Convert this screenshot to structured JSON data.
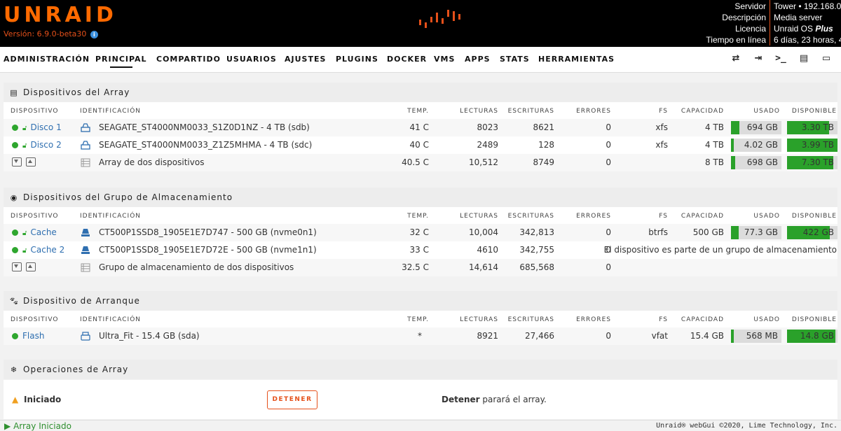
{
  "header": {
    "logo": "UNRAID",
    "version": "Versión: 6.9.0-beta30",
    "server_labels": [
      "Servidor",
      "Descripción",
      "Licencia",
      "Tiempo en línea"
    ],
    "server_values": [
      "Tower • 192.168.0",
      "Media server",
      "Unraid OS ",
      "6 días, 23 horas, 4"
    ],
    "license_plus": "Plus",
    "accent_color": "#ff6a00"
  },
  "nav": {
    "items": [
      "ADMINISTRACIÓN",
      "PRINCIPAL",
      "COMPARTIDO",
      "USUARIOS",
      "AJUSTES",
      "PLUGINS",
      "DOCKER",
      "VMS",
      "APPS",
      "STATS",
      "HERRAMIENTAS"
    ],
    "active": "PRINCIPAL",
    "right_icons": [
      "switch-icon",
      "logout-icon",
      "terminal-icon",
      "feedback-icon",
      "monitor-icon"
    ]
  },
  "columns": {
    "device": "DISPOSITIVO",
    "ident": "IDENTIFICACIÓN",
    "temp": "TEMP.",
    "reads": "LECTURAS",
    "writes": "ESCRITURAS",
    "errors": "ERRORES",
    "fs": "FS",
    "size": "CAPACIDAD",
    "used": "USADO",
    "free": "DISPONIBLE"
  },
  "array": {
    "title": "Dispositivos del Array",
    "rows": [
      {
        "device": "Disco 1",
        "ident": "SEAGATE_ST4000NM0033_S1Z0D1NZ - 4 TB (sdb)",
        "temp": "41 C",
        "reads": "8023",
        "writes": "8621",
        "errors": "0",
        "fs": "xfs",
        "size": "4 TB",
        "used": "694 GB",
        "used_pct": 0.17,
        "free": "3.30 TB",
        "free_pct": 0.83
      },
      {
        "device": "Disco 2",
        "ident": "SEAGATE_ST4000NM0033_Z1Z5MHMA - 4 TB (sdc)",
        "temp": "40 C",
        "reads": "2489",
        "writes": "128",
        "errors": "0",
        "fs": "xfs",
        "size": "4 TB",
        "used": "4.02 GB",
        "used_pct": 0.0,
        "free": "3.99 TB",
        "free_pct": 1.0
      }
    ],
    "summary": {
      "ident": "Array de dos dispositivos",
      "temp": "40.5 C",
      "reads": "10,512",
      "writes": "8749",
      "errors": "0",
      "size": "8 TB",
      "used": "698 GB",
      "used_pct": 0.09,
      "free": "7.30 TB",
      "free_pct": 0.91
    }
  },
  "pool": {
    "title": "Dispositivos del Grupo de Almacenamiento",
    "rows": [
      {
        "device": "Cache",
        "ident": "CT500P1SSD8_1905E1E7D747 - 500 GB (nvme0n1)",
        "temp": "32 C",
        "reads": "10,004",
        "writes": "342,813",
        "errors": "0",
        "fs": "btrfs",
        "size": "500 GB",
        "used": "77.3 GB",
        "used_pct": 0.15,
        "free": "422 GB",
        "free_pct": 0.85
      },
      {
        "device": "Cache 2",
        "ident": "CT500P1SSD8_1905E1E7D72E - 500 GB (nvme1n1)",
        "temp": "33 C",
        "reads": "4610",
        "writes": "342,755",
        "errors": "0",
        "note": "El dispositivo es parte de un grupo de almacenamiento"
      }
    ],
    "summary": {
      "ident": "Grupo de almacenamiento de dos dispositivos",
      "temp": "32.5 C",
      "reads": "14,614",
      "writes": "685,568",
      "errors": "0"
    }
  },
  "boot": {
    "title": "Dispositivo de Arranque",
    "rows": [
      {
        "device": "Flash",
        "ident": "Ultra_Fit - 15.4 GB (sda)",
        "temp": "*",
        "reads": "8921",
        "writes": "27,466",
        "errors": "0",
        "fs": "vfat",
        "size": "15.4 GB",
        "used": "568 MB",
        "used_pct": 0.04,
        "free": "14.8 GB",
        "free_pct": 0.96
      }
    ]
  },
  "ops": {
    "title": "Operaciones de Array",
    "status": "Iniciado",
    "stop_label": "DETENER",
    "desc_bold": "Detener",
    "desc_rest": " parará el array."
  },
  "footer": {
    "status": "Array Iniciado",
    "copyright": "Unraid® webGui ©2020, Lime Technology, Inc."
  }
}
